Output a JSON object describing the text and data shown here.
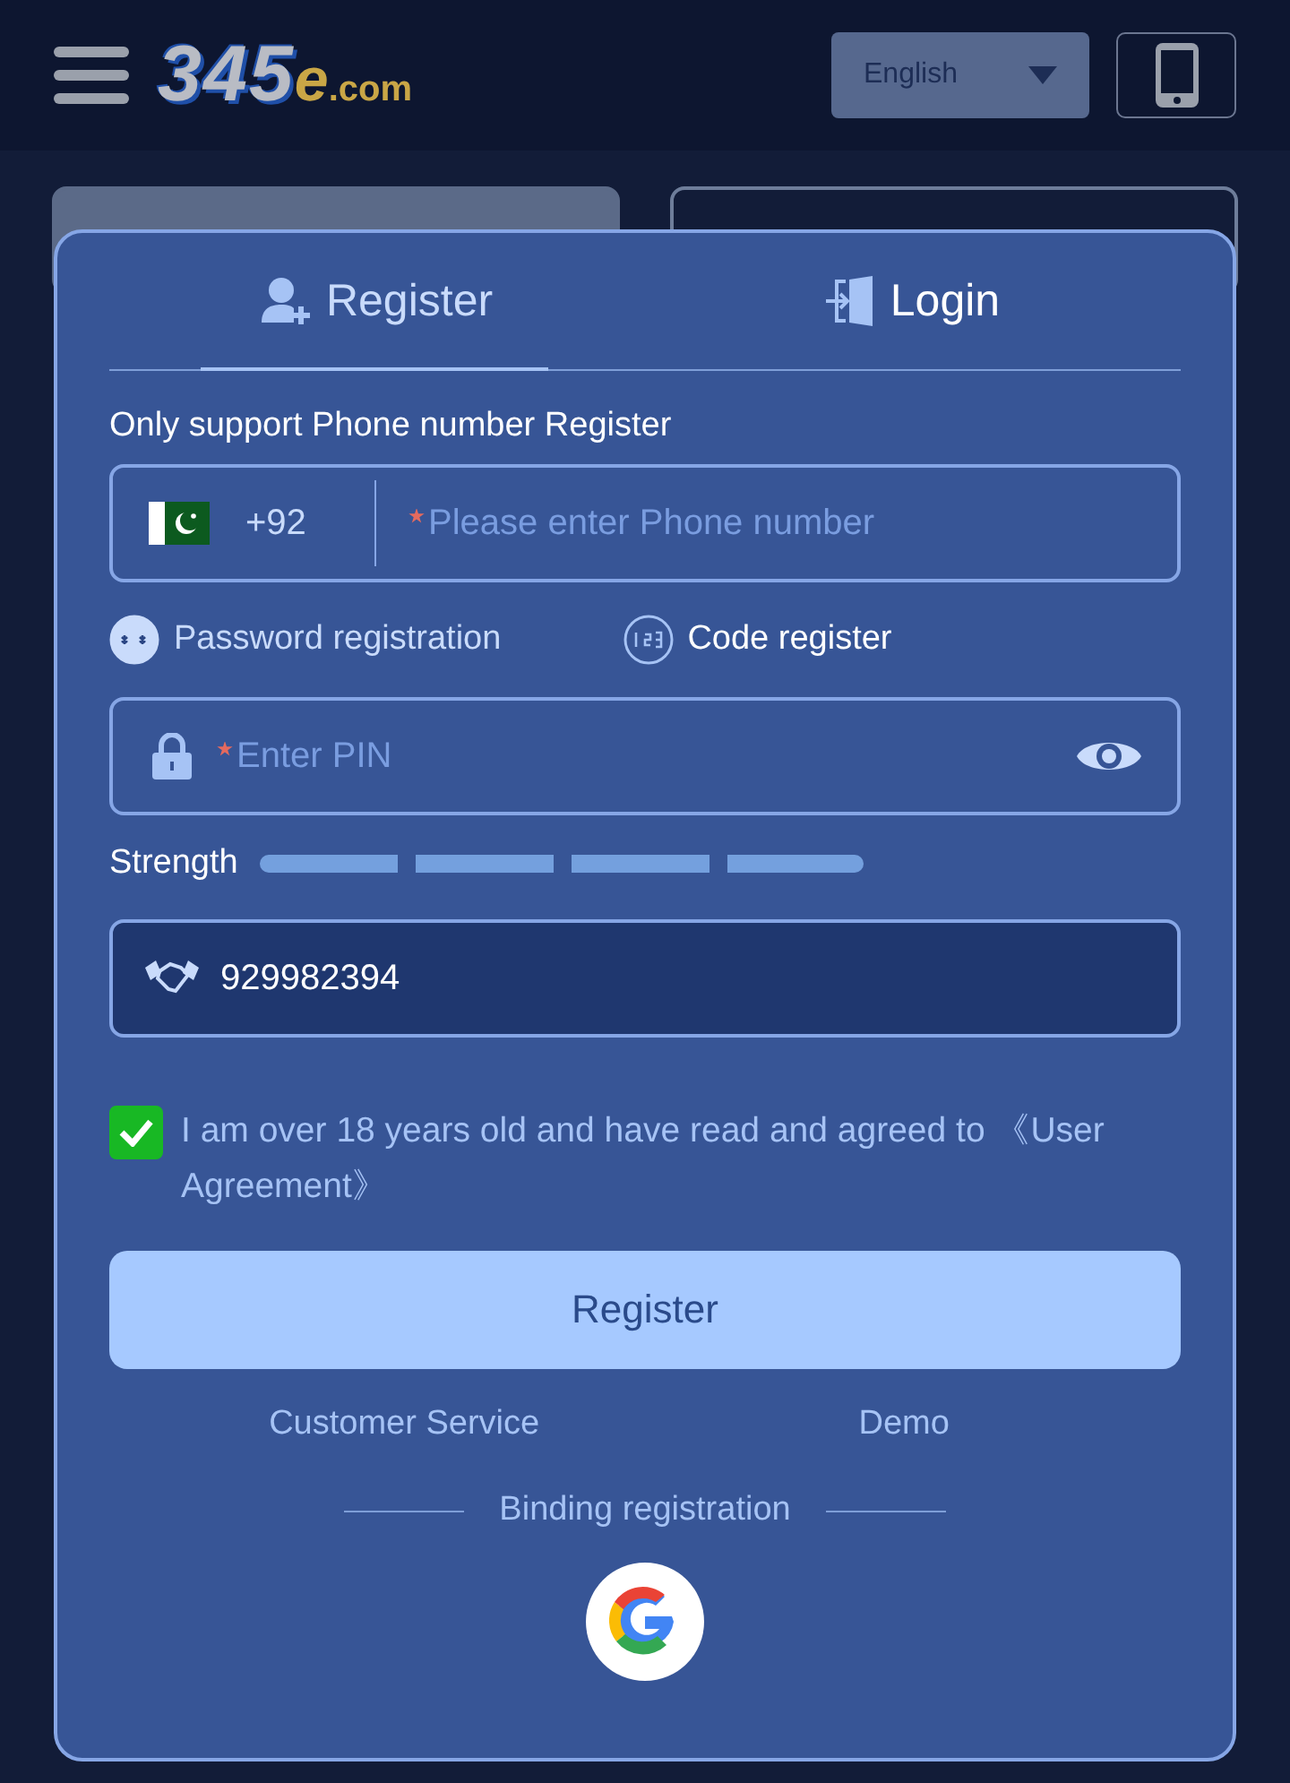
{
  "header": {
    "logo": {
      "digits": "345",
      "letter": "e",
      "domain": ".com"
    },
    "language": "English"
  },
  "background_tabs": [
    {
      "selected": true
    },
    {
      "selected": false
    }
  ],
  "modal": {
    "tabs": [
      {
        "label": "Register",
        "kind": "register",
        "selected": true
      },
      {
        "label": "Login",
        "kind": "login",
        "selected": false
      }
    ],
    "note": "Only support Phone number Register",
    "phone": {
      "code": "+92",
      "placeholder": "Please enter Phone number",
      "required": true
    },
    "modes": [
      {
        "label": "Password registration",
        "kind": "password",
        "selected": true
      },
      {
        "label": "Code register",
        "kind": "code",
        "selected": false
      }
    ],
    "pin": {
      "placeholder": "Enter PIN",
      "required": true
    },
    "strength": {
      "label": "Strength",
      "level": 0
    },
    "invite": {
      "value": "929982394"
    },
    "agreement": {
      "checked": true,
      "text": "I am over 18 years old and have read and agreed to 《User Agreement》"
    },
    "submit": "Register",
    "links": [
      "Customer Service",
      "Demo"
    ],
    "binding": "Binding registration"
  }
}
